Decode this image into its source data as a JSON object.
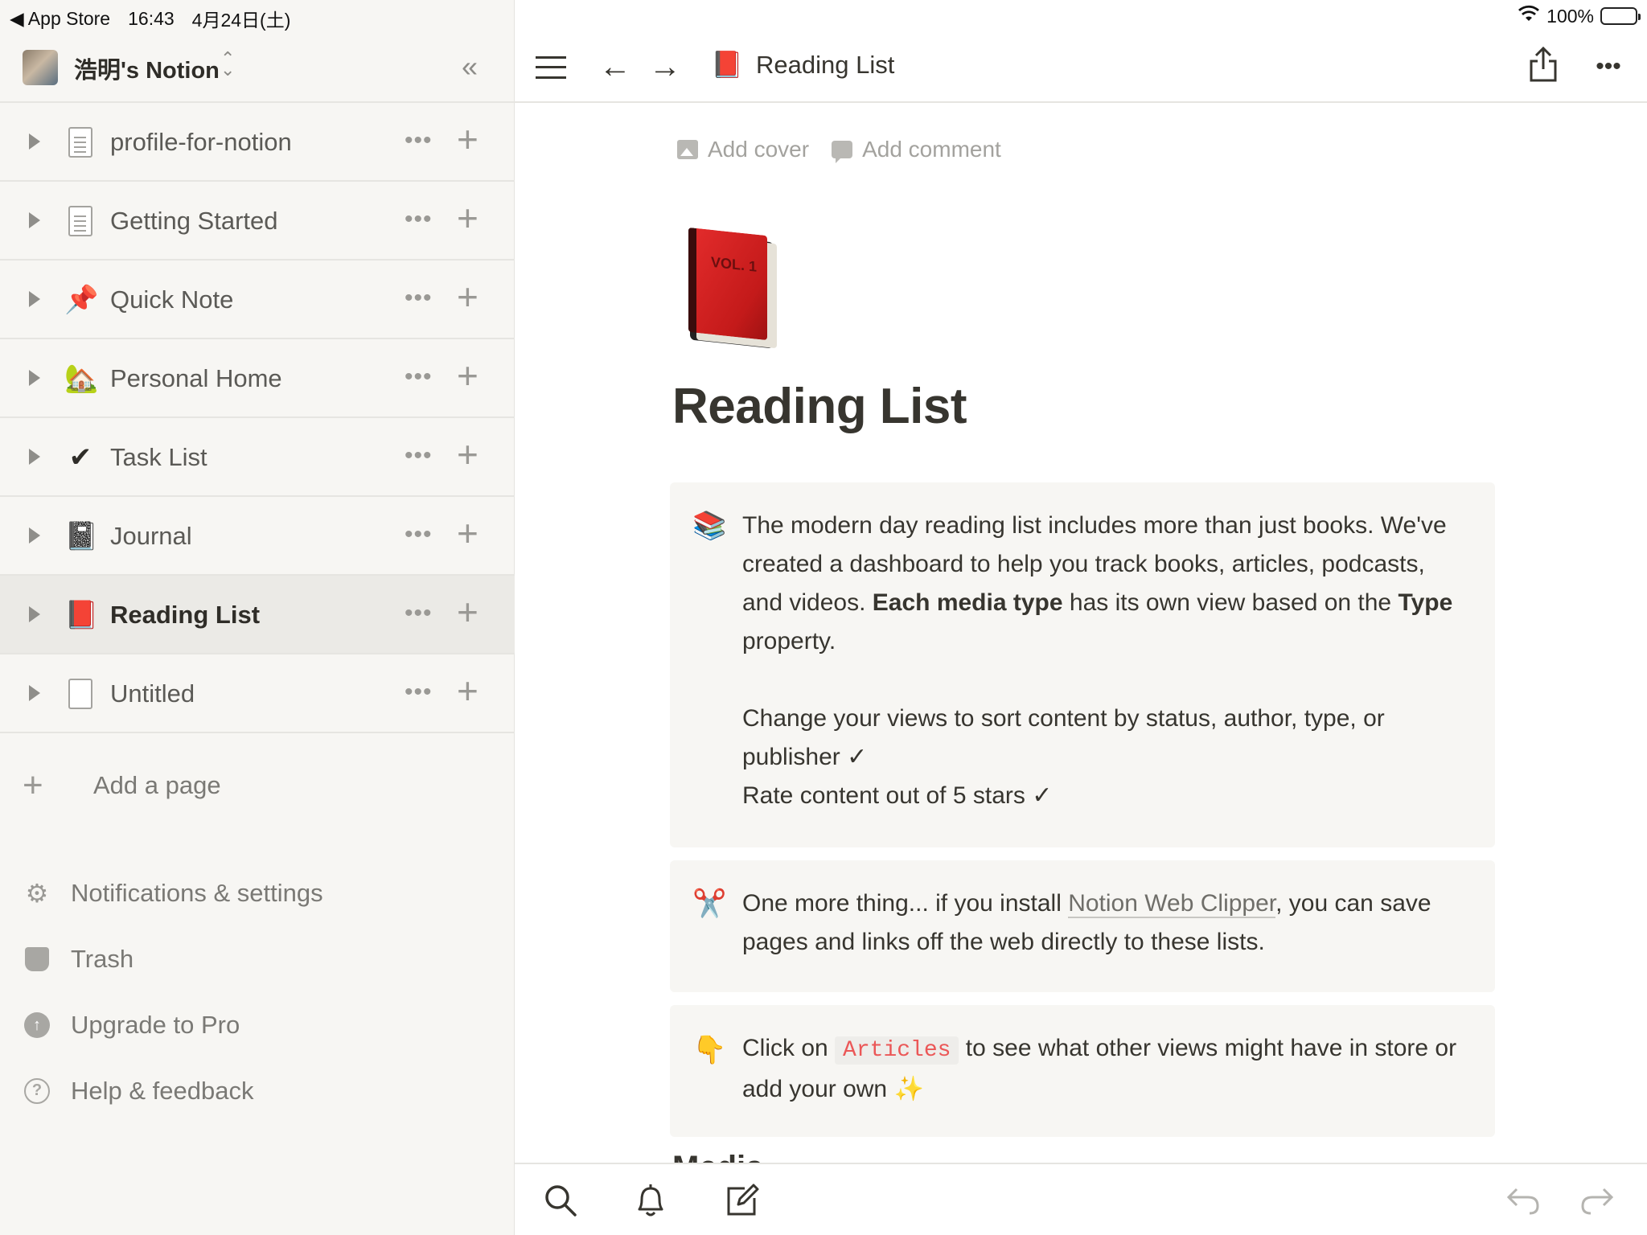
{
  "status_bar": {
    "back_app": "◀ App Store",
    "time": "16:43",
    "date": "4月24日(土)",
    "battery": "100%"
  },
  "sidebar": {
    "workspace_name": "浩明's Notion",
    "pages": [
      {
        "label": "profile-for-notion",
        "icon": "document-icon"
      },
      {
        "label": "Getting Started",
        "icon": "document-icon"
      },
      {
        "label": "Quick Note",
        "icon": "📌"
      },
      {
        "label": "Personal Home",
        "icon": "🏡"
      },
      {
        "label": "Task List",
        "icon": "✔"
      },
      {
        "label": "Journal",
        "icon": "📓"
      },
      {
        "label": "Reading List",
        "icon": "📕",
        "active": true
      },
      {
        "label": "Untitled",
        "icon": "blank-document-icon"
      }
    ],
    "add_page": "Add a page",
    "links": {
      "settings": "Notifications & settings",
      "trash": "Trash",
      "upgrade": "Upgrade to Pro",
      "help": "Help & feedback"
    }
  },
  "topbar": {
    "title": "Reading List",
    "page_icon": "📕"
  },
  "page": {
    "add_cover": "Add cover",
    "add_comment": "Add comment",
    "book_label": "VOL. 1",
    "title": "Reading List",
    "callout1": {
      "icon": "📚",
      "p1_a": "The modern day reading list includes more than just books. We've created a dashboard to help you track books, articles, podcasts, and videos. ",
      "p1_bold1": "Each media type",
      "p1_b": " has its own view based on the ",
      "p1_bold2": "Type",
      "p1_c": " property.",
      "p2": "Change your views to sort content by status, author, type, or publisher ✓",
      "p3": "Rate content out of 5 stars ✓"
    },
    "callout2": {
      "icon": "✂️",
      "text_a": "One more thing... if you install ",
      "link": "Notion Web Clipper",
      "text_b": ", you can save pages and links off the web directly to these lists."
    },
    "callout3": {
      "icon": "👇",
      "text_a": "Click on ",
      "code": "Articles",
      "text_b": " to see what other views might have in store or add your own ",
      "sparkle": "✨"
    },
    "next_heading": "Media"
  },
  "colors": {
    "sidebar_bg": "#f7f6f3",
    "active_row": "#ebeae6",
    "text": "#37352f",
    "code_red": "#eb5757",
    "battery_green": "#34c759"
  }
}
